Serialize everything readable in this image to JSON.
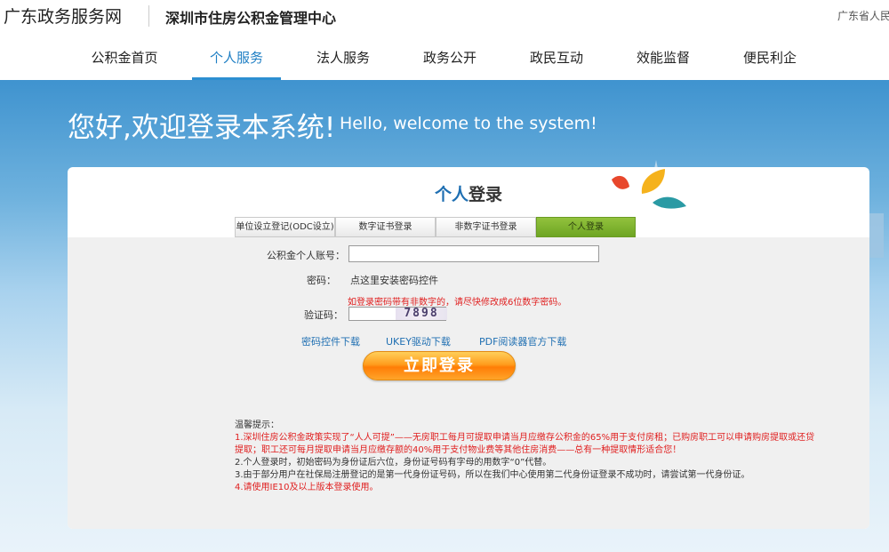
{
  "header": {
    "portal_name": "广东政务服务网",
    "center_name": "深圳市住房公积金管理中心",
    "right_link": "广东省人民"
  },
  "nav": {
    "items": [
      {
        "label": "公积金首页",
        "active": false
      },
      {
        "label": "个人服务",
        "active": true
      },
      {
        "label": "法人服务",
        "active": false
      },
      {
        "label": "政务公开",
        "active": false
      },
      {
        "label": "政民互动",
        "active": false
      },
      {
        "label": "效能监督",
        "active": false
      },
      {
        "label": "便民利企",
        "active": false
      }
    ]
  },
  "banner": {
    "welcome_cn": "您好,欢迎登录本系统!",
    "welcome_en": "Hello, welcome to the system!"
  },
  "panel": {
    "title_part1": "个人",
    "title_part2": "登录",
    "tabs": [
      {
        "label": "单位设立登记(ODC设立)",
        "active": false
      },
      {
        "label": "数字证书登录",
        "active": false
      },
      {
        "label": "非数字证书登录",
        "active": false
      },
      {
        "label": "个人登录",
        "active": true
      }
    ]
  },
  "form": {
    "account_label": "公积金个人账号：",
    "account_value": "",
    "password_label": "密码：",
    "password_control_link": "点这里安装密码控件",
    "password_warning": "如登录密码带有非数字的，请尽快修改成6位数字密码。",
    "captcha_label": "验证码：",
    "captcha_value": "",
    "captcha_code": "7898",
    "links": [
      "密码控件下载",
      "UKEY驱动下载",
      "PDF阅读器官方下载"
    ],
    "login_button": "立即登录"
  },
  "tips": {
    "heading": "温馨提示：",
    "line1": "1.深圳住房公积金政策实现了“人人可提”——无房职工每月可提取申请当月应缴存公积金的65%用于支付房租；已购房职工可以申请购房提取或还贷提取；职工还可每月提取申请当月应缴存额的40%用于支付物业费等其他住房消费——总有一种提取情形适合您！",
    "line2": "2.个人登录时，初始密码为身份证后六位，身份证号码有字母的用数字“0”代替。",
    "line3": "3.由于部分用户在社保局注册登记的是第一代身份证号码，所以在我们中心使用第二代身份证登录不成功时，请尝试第一代身份证。",
    "line4": "4.请使用IE10及以上版本登录使用。"
  },
  "colors": {
    "accent_blue": "#2d8fd1",
    "active_tab_green": "#7ab02c",
    "button_orange": "#ff8c10",
    "warning_red": "#e02020"
  }
}
